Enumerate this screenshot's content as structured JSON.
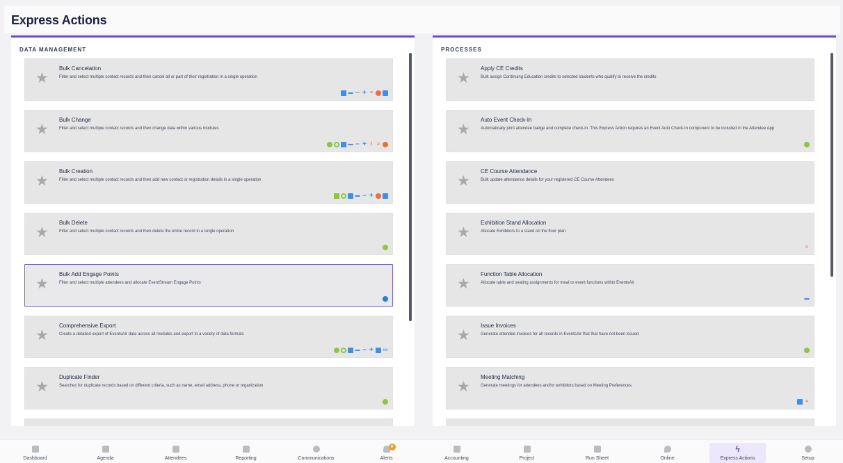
{
  "page": {
    "title": "Express Actions"
  },
  "colors": {
    "accent": "#6a48e0",
    "blue": "#3f8ee8",
    "green": "#8dc63f",
    "orange": "#f26b3a",
    "badge": "#f39c1f"
  },
  "left_panel": {
    "header": "DATA MANAGEMENT",
    "cards": [
      {
        "title": "Bulk Cancelation",
        "desc": "Filter and select multiple contact records and then cancel all or part of their registration in a single operation",
        "icons": [
          "badge-icon",
          "desk-icon",
          "bed-icon",
          "plane-icon",
          "handshake-icon",
          "cancel-icon",
          "calendar-icon"
        ]
      },
      {
        "title": "Bulk Change",
        "desc": "Filter and select multiple contact records and then change data within various modules",
        "icons": [
          "user-icon",
          "target-icon",
          "badge-icon",
          "desk-icon",
          "bed-icon",
          "plane-icon",
          "mic-icon",
          "handshake-icon",
          "cancel-icon"
        ]
      },
      {
        "title": "Bulk Creation",
        "desc": "Filter and select multiple contact records and then add new contact or registration details in a single operation",
        "icons": [
          "note-icon",
          "target-icon",
          "badge-icon",
          "desk-icon",
          "bed-icon",
          "plane-icon",
          "cancel-icon",
          "calendar-icon"
        ]
      },
      {
        "title": "Bulk Delete",
        "desc": "Filter and select multiple contact records and then delete the entire record in a single operation",
        "icons": [
          "user-icon"
        ]
      },
      {
        "title": "Bulk Add Engage Points",
        "desc": "Filter and select multiple attendees and allocate EventStream Engage Points",
        "icons": [
          "chat-icon"
        ]
      },
      {
        "title": "Comprehensive Export",
        "desc": "Create a detailed export of EventsAir data across all modules and export to a variety of data formats",
        "icons": [
          "user-icon",
          "target-icon",
          "badge-icon",
          "desk-icon",
          "bed-icon",
          "plane-icon",
          "calendar-icon",
          "card-icon"
        ]
      },
      {
        "title": "Duplicate Finder",
        "desc": "Searches for duplicate records based on different criteria, such as name, email address, phone or organization",
        "icons": [
          "user-icon"
        ]
      }
    ]
  },
  "right_panel": {
    "header": "PROCESSES",
    "cards": [
      {
        "title": "Apply CE Credits",
        "desc": "Bulk assign Continuing Education credits to selected students who qualify to receive the credits",
        "icons": []
      },
      {
        "title": "Auto Event Check-In",
        "desc": "Automatically print attendee badge and complete check-in. This Express Action requires an Event Auto Check-In component to be included in the Attendee App",
        "icons": [
          "user-icon"
        ]
      },
      {
        "title": "CE Course Attendance",
        "desc": "Bulk update attendance details for your registered CE Course Attendees",
        "icons": []
      },
      {
        "title": "Exhibition Stand Allocation",
        "desc": "Allocate Exhibitors to a stand on the floor plan",
        "icons": [
          "handshake-icon"
        ]
      },
      {
        "title": "Function Table Allocation",
        "desc": "Allocate table and seating assignments for meal or event functions within EventsAir",
        "icons": [
          "desk-icon"
        ]
      },
      {
        "title": "Issue Invoices",
        "desc": "Generate attendee invoices for all records in EventsAir that that have not been issued",
        "icons": [
          "user-icon"
        ]
      },
      {
        "title": "Meeting Matching",
        "desc": "Generate meetings for attendees and/or exhibitors based on Meeting Preferences",
        "icons": [
          "badge-icon",
          "handshake-icon"
        ]
      }
    ]
  },
  "nav": {
    "items": [
      {
        "label": "Dashboard",
        "icon": "dashboard-icon"
      },
      {
        "label": "Agenda",
        "icon": "calendar-icon"
      },
      {
        "label": "Attendees",
        "icon": "badge-icon"
      },
      {
        "label": "Reporting",
        "icon": "report-icon"
      },
      {
        "label": "Communications",
        "icon": "chat-icon"
      },
      {
        "label": "Alerts",
        "icon": "bell-icon",
        "badge": "0"
      },
      {
        "label": "Accounting",
        "icon": "calculator-icon"
      },
      {
        "label": "Project",
        "icon": "folder-icon"
      },
      {
        "label": "Run Sheet",
        "icon": "list-icon"
      },
      {
        "label": "Online",
        "icon": "pin-icon"
      },
      {
        "label": "Express Actions",
        "icon": "lightning-icon",
        "active": true
      },
      {
        "label": "Setup",
        "icon": "gear-icon"
      }
    ]
  }
}
